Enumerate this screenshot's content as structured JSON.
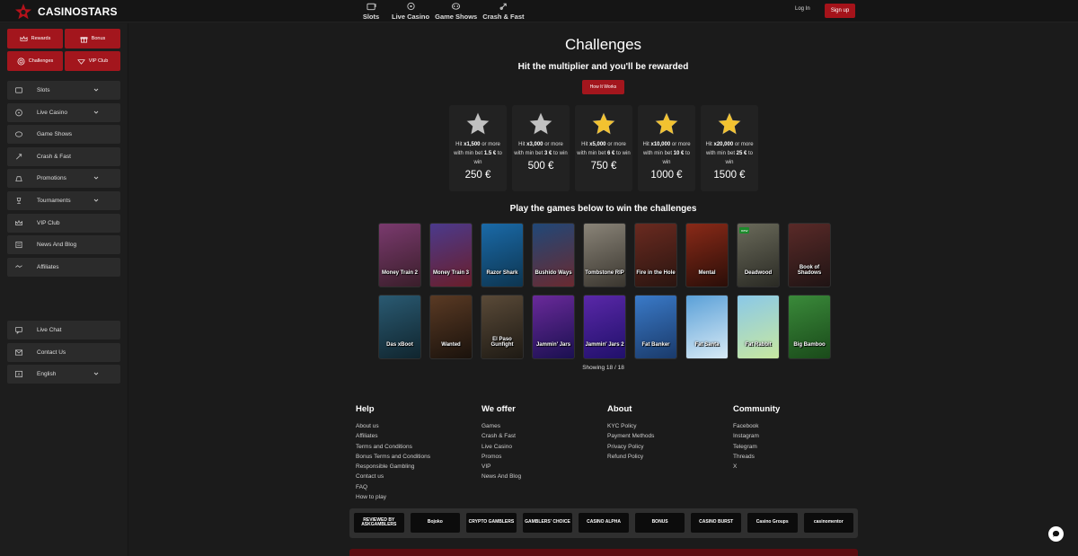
{
  "brand": {
    "name": "CASINOSTARS",
    "accent": "#a3161d"
  },
  "topnav": [
    {
      "label": "Slots",
      "icon": "slot-machine-icon"
    },
    {
      "label": "Live Casino",
      "icon": "roulette-icon"
    },
    {
      "label": "Game Shows",
      "icon": "game-show-icon"
    },
    {
      "label": "Crash & Fast",
      "icon": "rocket-icon"
    }
  ],
  "auth": {
    "login": "Log In",
    "signup": "Sign up"
  },
  "quick": [
    {
      "label": "Rewards",
      "icon": "crown-icon"
    },
    {
      "label": "Bonus",
      "icon": "gift-icon"
    },
    {
      "label": "Challenges",
      "icon": "target-icon"
    },
    {
      "label": "VIP Club",
      "icon": "vip-icon"
    }
  ],
  "menu": [
    {
      "label": "Slots",
      "icon": "slot-machine-icon",
      "chevron": true
    },
    {
      "label": "Live Casino",
      "icon": "roulette-icon",
      "chevron": true
    },
    {
      "label": "Game Shows",
      "icon": "game-show-icon",
      "chevron": false
    },
    {
      "label": "Crash & Fast",
      "icon": "rocket-icon",
      "chevron": false
    },
    {
      "label": "Promotions",
      "icon": "money-bag-icon",
      "chevron": true
    },
    {
      "label": "Tournaments",
      "icon": "trophy-icon",
      "chevron": true
    },
    {
      "label": "VIP Club",
      "icon": "crown-icon",
      "chevron": false
    },
    {
      "label": "News And Blog",
      "icon": "news-icon",
      "chevron": false
    },
    {
      "label": "Affiliates",
      "icon": "handshake-icon",
      "chevron": false
    }
  ],
  "menu2": [
    {
      "label": "Live Chat",
      "icon": "chat-icon",
      "chevron": false
    },
    {
      "label": "Contact Us",
      "icon": "mail-icon",
      "chevron": false
    },
    {
      "label": "English",
      "icon": "language-icon",
      "chevron": true
    }
  ],
  "page": {
    "title": "Challenges",
    "subtitle": "Hit the multiplier and you'll be rewarded",
    "how_button": "How It Works",
    "games_title": "Play the games below to win the challenges",
    "showing": "Showing 18 / 18"
  },
  "challenges": [
    {
      "star": "#c0c0c0",
      "mult": "x1,500",
      "bet": "1.5 €",
      "prize": "250 €"
    },
    {
      "star": "#c0c0c0",
      "mult": "x3,000",
      "bet": "3 €",
      "prize": "500 €"
    },
    {
      "star": "#f2c230",
      "mult": "x5,000",
      "bet": "6 €",
      "prize": "750 €"
    },
    {
      "star": "#f2c230",
      "mult": "x10,000",
      "bet": "10 €",
      "prize": "1000 €"
    },
    {
      "star": "#f2c230",
      "mult": "x20,000",
      "bet": "25 €",
      "prize": "1500 €"
    }
  ],
  "challenge_text": {
    "hit": "Hit",
    "more": "or more with min bet",
    "towin": "to win"
  },
  "games": [
    {
      "title": "Money Train 2",
      "c1": "#7a3a6e",
      "c2": "#3a1e2a"
    },
    {
      "title": "Money Train 3",
      "c1": "#4b3a8c",
      "c2": "#6a1e2a"
    },
    {
      "title": "Razor Shark",
      "c1": "#1a6aa8",
      "c2": "#0d3550"
    },
    {
      "title": "Bushido Ways",
      "c1": "#204878",
      "c2": "#6a2a30"
    },
    {
      "title": "Tombstone RIP",
      "c1": "#8a8478",
      "c2": "#3a362f"
    },
    {
      "title": "Fire in the Hole",
      "c1": "#6a2a20",
      "c2": "#2a1510"
    },
    {
      "title": "Mental",
      "c1": "#8a2a18",
      "c2": "#2a0e08"
    },
    {
      "title": "Deadwood",
      "c1": "#6a6a5a",
      "c2": "#2a2a24",
      "badge": "new"
    },
    {
      "title": "Book of Shadows",
      "c1": "#5a2a28",
      "c2": "#1f1414"
    },
    {
      "title": "Das xBoot",
      "c1": "#2a5a72",
      "c2": "#10252e"
    },
    {
      "title": "Wanted",
      "c1": "#5a3a24",
      "c2": "#1a120c"
    },
    {
      "title": "El Paso Gunfight",
      "c1": "#5a4a38",
      "c2": "#1e1a14"
    },
    {
      "title": "Jammin' Jars",
      "c1": "#6a2a9a",
      "c2": "#1a1050"
    },
    {
      "title": "Jammin' Jars 2",
      "c1": "#5a28a8",
      "c2": "#20106a"
    },
    {
      "title": "Fat Banker",
      "c1": "#3a7ac8",
      "c2": "#1a3a6a"
    },
    {
      "title": "Fat Santa",
      "c1": "#5aa0d8",
      "c2": "#d8eaf5"
    },
    {
      "title": "Fat Rabbit",
      "c1": "#8ac8e8",
      "c2": "#c8e8a0"
    },
    {
      "title": "Big Bamboo",
      "c1": "#3a8a3a",
      "c2": "#1a4a1a"
    }
  ],
  "footer": [
    {
      "heading": "Help",
      "links": [
        "About us",
        "Affiliates",
        "Terms and Conditions",
        "Bonus Terms and Conditions",
        "Responsible Gambling",
        "Contact us",
        "FAQ",
        "How to play"
      ]
    },
    {
      "heading": "We offer",
      "links": [
        "Games",
        "Crash & Fast",
        "Live Casino",
        "Promos",
        "VIP",
        "News And Blog"
      ]
    },
    {
      "heading": "About",
      "links": [
        "KYC Policy",
        "Payment Methods",
        "Privacy Policy",
        "Refund Policy"
      ]
    },
    {
      "heading": "Community",
      "links": [
        "Facebook",
        "Instagram",
        "Telegram",
        "Threads",
        "X"
      ]
    }
  ],
  "partners": [
    "REVIEWED BY ASKGAMBLERS",
    "Bojoko",
    "CRYPTO GAMBLERS",
    "GAMBLERS' CHOICE",
    "CASINO ALPHA",
    "BONUS",
    "CASINO BURST",
    "Casino Groups",
    "casinomentor"
  ]
}
